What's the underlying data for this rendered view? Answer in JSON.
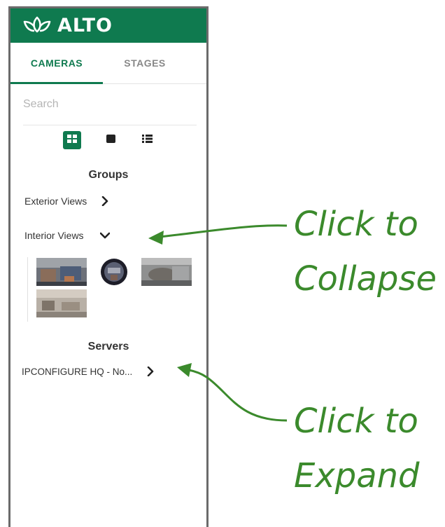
{
  "brand": {
    "name": "ALTO",
    "bar_color": "#0f7a4f",
    "logo_icon": "lotus-icon"
  },
  "tabs": [
    {
      "label": "CAMERAS",
      "active": true
    },
    {
      "label": "STAGES",
      "active": false
    }
  ],
  "search": {
    "placeholder": "Search",
    "value": ""
  },
  "view_modes": [
    {
      "icon": "grid-view-icon",
      "active": true
    },
    {
      "icon": "single-view-icon",
      "active": false
    },
    {
      "icon": "list-view-icon",
      "active": false
    }
  ],
  "groups": {
    "title": "Groups",
    "items": [
      {
        "label": "Exterior Views",
        "state": "collapsed",
        "chevron": "chevron-right-icon"
      },
      {
        "label": "Interior Views",
        "state": "expanded",
        "chevron": "chevron-down-icon"
      }
    ],
    "thumbnails": [
      {
        "name": "camera-thumbnail-1"
      },
      {
        "name": "camera-thumbnail-2-fisheye"
      },
      {
        "name": "camera-thumbnail-3"
      },
      {
        "name": "camera-thumbnail-4"
      }
    ]
  },
  "servers": {
    "title": "Servers",
    "items": [
      {
        "label": "IPCONFIGURE HQ - No...",
        "chevron": "chevron-right-icon"
      }
    ]
  },
  "annotations": {
    "collapse_line1": "Click to",
    "collapse_line2": "Collapse",
    "expand_line1": "Click to",
    "expand_line2": "Expand",
    "color": "#3b8a2c"
  }
}
